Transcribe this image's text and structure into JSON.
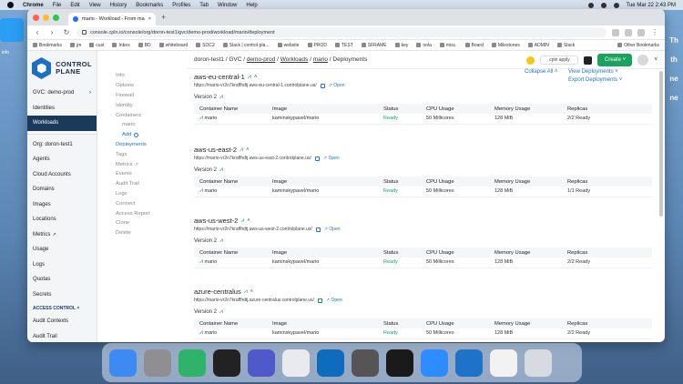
{
  "menubar": {
    "app": "Chrome",
    "menus": [
      "File",
      "Edit",
      "View",
      "History",
      "Bookmarks",
      "Profiles",
      "Tab",
      "Window",
      "Help"
    ],
    "clock": "Tue Mar 22  2:43 PM"
  },
  "desktop": {
    "label": "info",
    "edge_letters": [
      "Th",
      "th",
      "ne",
      "ne"
    ]
  },
  "browser": {
    "tab_title": "mario - Workload - From mar",
    "url": "console.cpln.io/console/org/doron-test1/gvc/demo-prod/workload/mario/deployment",
    "bookmarks": [
      "Bookmarks",
      "jm",
      "cust",
      "Inbox",
      "BD",
      "whiteboard",
      "SOC2",
      "Slack | control-pla...",
      "website",
      "PROD",
      "TEST",
      "SFRAME",
      "key",
      "nola",
      "misc.",
      "Board",
      "Milestones",
      "ADMIN",
      "Slack"
    ],
    "other_bookmarks": "Other Bookmarks"
  },
  "logo": {
    "line1": "CONTROL",
    "line2": "PLANE"
  },
  "sidebar": {
    "gvc": "GVC: demo-prod",
    "items1": [
      "Identities",
      "Workloads"
    ],
    "org": "Org: doron-test1",
    "items2": [
      "Agents",
      "Cloud Accounts",
      "Domains",
      "Images",
      "Locations",
      "Metrics",
      "Usage",
      "Logs",
      "Quotas",
      "Secrets"
    ],
    "access_control": "ACCESS CONTROL",
    "items3": [
      "Audit Contexts",
      "Audit Trail"
    ]
  },
  "subnav": {
    "info": "Info",
    "options": "Options",
    "firewall": "Firewall",
    "identity": "Identity",
    "containers": "Containers",
    "container_mario": "mario",
    "add": "Add",
    "deployments": "Deployments",
    "tags": "Tags",
    "metrics": "Metrics",
    "events": "Events",
    "audit_trail": "Audit Trail",
    "logs": "Logs",
    "connect": "Connect",
    "access_report": "Access Report",
    "clone": "Clone",
    "delete": "Delete"
  },
  "breadcrumb": {
    "org": "doron-test1",
    "gvc": "GVC",
    "gvc_name": "demo-prod",
    "workloads": "Workloads",
    "workload": "mario",
    "page": "Deployments"
  },
  "top": {
    "cli": "cpln apply",
    "create": "Create"
  },
  "links": {
    "collapse": "Collapse All",
    "view": "View Deployments",
    "export": "Export Deployments"
  },
  "table_headers": {
    "container": "Container Name",
    "image": "Image",
    "status": "Status",
    "cpu": "CPU Usage",
    "memory": "Memory Usage",
    "replicas": "Replicas"
  },
  "open_label": "Open",
  "regions": [
    {
      "name": "aws-eu-central-1",
      "url": "https://mario-vr2n7kraffhdtj.aws-eu-central-1.controlplane.us/",
      "version": "Version 2",
      "row": {
        "container": "mario",
        "image": "kaminskypavel/mario",
        "status": "Ready",
        "cpu": "50 Millicores",
        "memory": "128 MiB",
        "replicas": "2/2 Ready"
      }
    },
    {
      "name": "aws-us-east-2",
      "url": "https://mario-vr2n7kraffhdtj.aws-us-east-2.controlplane.us/",
      "version": "Version 2",
      "row": {
        "container": "mario",
        "image": "kaminskypavel/mario",
        "status": "Ready",
        "cpu": "50 Millicores",
        "memory": "128 MiB",
        "replicas": "1/1 Ready"
      }
    },
    {
      "name": "aws-us-west-2",
      "url": "https://mario-vr2n7kraffhdtj.aws-us-west-2.controlplane.us/",
      "version": "Version 2",
      "row": {
        "container": "mario",
        "image": "kaminskypavel/mario",
        "status": "Ready",
        "cpu": "50 Millicores",
        "memory": "128 MiB",
        "replicas": "2/2 Ready"
      }
    },
    {
      "name": "azure-centralus",
      "url": "https://mario-vr2n7kraffhdtj.azure-centralus.controlplane.us/",
      "version": "Version 2",
      "row": {
        "container": "mario",
        "image": "kaminskypavel/mario",
        "status": "Ready",
        "cpu": "50 Millicores",
        "memory": "128 MiB",
        "replicas": "2/2 Ready"
      }
    }
  ],
  "colors": {
    "accent": "#1f73d1",
    "ready": "#1aa260",
    "sidebar_active": "#1a3a5c",
    "create": "#1aa260"
  },
  "dock_apps": [
    {
      "name": "finder",
      "color": "#3d8bf2"
    },
    {
      "name": "system-preferences",
      "color": "#8e8e93"
    },
    {
      "name": "network-app",
      "color": "#2fb36b"
    },
    {
      "name": "terminal",
      "color": "#222222"
    },
    {
      "name": "teams",
      "color": "#5059c9"
    },
    {
      "name": "chrome",
      "color": "#e8eaed"
    },
    {
      "name": "outlook",
      "color": "#0f6cbd"
    },
    {
      "name": "calculator",
      "color": "#555555"
    },
    {
      "name": "logitech",
      "color": "#1a1a1a"
    },
    {
      "name": "zoom",
      "color": "#2d8cff"
    },
    {
      "name": "vscode",
      "color": "#1e73c8"
    },
    {
      "name": "preview",
      "color": "#f2f2f2"
    },
    {
      "name": "trash",
      "color": "#d6dbe2"
    }
  ]
}
